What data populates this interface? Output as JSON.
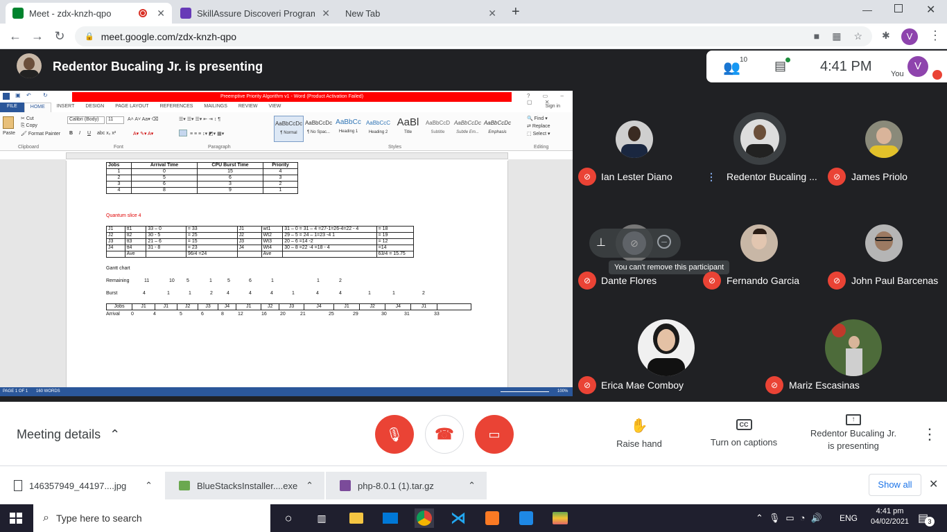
{
  "browser": {
    "tabs": [
      {
        "title": "Meet - zdx-knzh-qpo",
        "color": "#00832d"
      },
      {
        "title": "SkillAssure Discoveri Program (Pl",
        "color": "#673ab7"
      },
      {
        "title": "New Tab",
        "color": ""
      }
    ],
    "url": "meet.google.com/zdx-knzh-qpo",
    "profile_initial": "V"
  },
  "meet": {
    "presenting_banner": "Redentor Bucaling Jr. is presenting",
    "participant_count": "10",
    "time": "4:41 PM",
    "you_label": "You",
    "you_initial": "V",
    "tooltip": "You can't remove this participant",
    "participants": [
      {
        "name": "Ian Lester Diano",
        "mic": "off"
      },
      {
        "name": "Redentor Bucaling ...",
        "mic": "speaking"
      },
      {
        "name": "James Priolo",
        "mic": "off"
      },
      {
        "name": "Dante Flores",
        "mic": "off"
      },
      {
        "name": "Fernando Garcia",
        "mic": "off"
      },
      {
        "name": "John Paul Barcenas",
        "mic": "off"
      },
      {
        "name": "Erica Mae Comboy",
        "mic": "off"
      },
      {
        "name": "Mariz Escasinas",
        "mic": "off"
      }
    ],
    "meeting_details": "Meeting details",
    "raise_hand": "Raise hand",
    "captions": "Turn on captions",
    "presenting_line1": "Redentor Bucaling Jr.",
    "presenting_line2": "is presenting"
  },
  "word": {
    "title": "Preemptive Priority Algorithm v1 - Word (Product Activation Failed)",
    "menu": [
      "FILE",
      "HOME",
      "INSERT",
      "DESIGN",
      "PAGE LAYOUT",
      "REFERENCES",
      "MAILINGS",
      "REVIEW",
      "VIEW"
    ],
    "sign_in": "Sign in",
    "font_name": "Calibri (Body)",
    "font_size": "11",
    "clipboard": {
      "paste": "Paste",
      "cut": "Cut",
      "copy": "Copy",
      "format_painter": "Format Painter",
      "group": "Clipboard"
    },
    "groups": {
      "font": "Font",
      "paragraph": "Paragraph",
      "styles": "Styles",
      "editing": "Editing"
    },
    "styles": [
      {
        "sample": "AaBbCcDc",
        "name": "¶ Normal"
      },
      {
        "sample": "AaBbCcDc",
        "name": "¶ No Spac..."
      },
      {
        "sample": "AaBbCc",
        "name": "Heading 1"
      },
      {
        "sample": "AaBbCcC",
        "name": "Heading 2"
      },
      {
        "sample": "AaBl",
        "name": "Title"
      },
      {
        "sample": "AaBbCcD",
        "name": "Subtitle"
      },
      {
        "sample": "AaBbCcDc",
        "name": "Subtle Em..."
      },
      {
        "sample": "AaBbCcDc",
        "name": "Emphasis"
      }
    ],
    "editing": {
      "find": "Find",
      "replace": "Replace",
      "select": "Select"
    },
    "status": {
      "page": "PAGE 1 OF 1",
      "words": "160 WORDS",
      "zoom": "100%"
    },
    "jobs_table": {
      "headers": [
        "Jobs",
        "Arrival Time",
        "CPU Burst Time",
        "Priority"
      ],
      "rows": [
        [
          "1",
          "0",
          "15",
          "4"
        ],
        [
          "2",
          "5",
          "6",
          "3"
        ],
        [
          "3",
          "6",
          "3",
          "2"
        ],
        [
          "4",
          "8",
          "9",
          "1"
        ]
      ]
    },
    "quantum_label": "Quantum slice 4",
    "q_table": [
      [
        "J1",
        "tt1",
        "33 – 0",
        "= 33",
        "J1",
        "wt1",
        "31 – 0 = 31 – 4 =27-1=26-4=22 - 4",
        "= 18"
      ],
      [
        "J2",
        "tt2",
        "30 - 5",
        "= 25",
        "J2",
        "Wt2",
        "29 – 5 = 24 – 1=23 -4 1",
        "= 19"
      ],
      [
        "J3",
        "tt3",
        "21 – 6",
        "= 15",
        "J3",
        "Wt3",
        "20 – 6 =14 -2",
        "= 12"
      ],
      [
        "J4",
        "tt4",
        "31 - 8",
        "= 23",
        "J4",
        "Wt4",
        "30 – 8 =22 -4 =18 - 4",
        "=14"
      ],
      [
        "",
        "Ave",
        "",
        "96/4 =24",
        "",
        "Ave",
        "",
        "63/4 = 15.75"
      ]
    ],
    "gantt_label": "Gantt chart",
    "remaining_label": "Remaining",
    "remaining": [
      "11",
      "10",
      "5",
      "1",
      "5",
      "6",
      "1",
      "1",
      "2"
    ],
    "burst_label": "Burst",
    "burst": [
      "4",
      "1",
      "1",
      "2",
      "4",
      "4",
      "4",
      "1",
      "4",
      "4",
      "1",
      "1",
      "2"
    ],
    "gantt_jobs": [
      "Jobs",
      "J1",
      "J1",
      "J2",
      "J3",
      "J4",
      "J1",
      "J2",
      "J3",
      "J4",
      "J1",
      "J2",
      "J4",
      "J1",
      ""
    ],
    "arrival_label": "Arrival",
    "arrival": [
      "0",
      "4",
      "5",
      "6",
      "8",
      "12",
      "16",
      "20",
      "21",
      "25",
      "29",
      "30",
      "31",
      "33"
    ]
  },
  "downloads": {
    "items": [
      "146357949_44197....jpg",
      "BlueStacksInstaller....exe",
      "php-8.0.1 (1).tar.gz"
    ],
    "show_all": "Show all"
  },
  "taskbar": {
    "search_placeholder": "Type here to search",
    "lang": "ENG",
    "time": "4:41 pm",
    "date": "04/02/2021",
    "notif_count": "3"
  }
}
